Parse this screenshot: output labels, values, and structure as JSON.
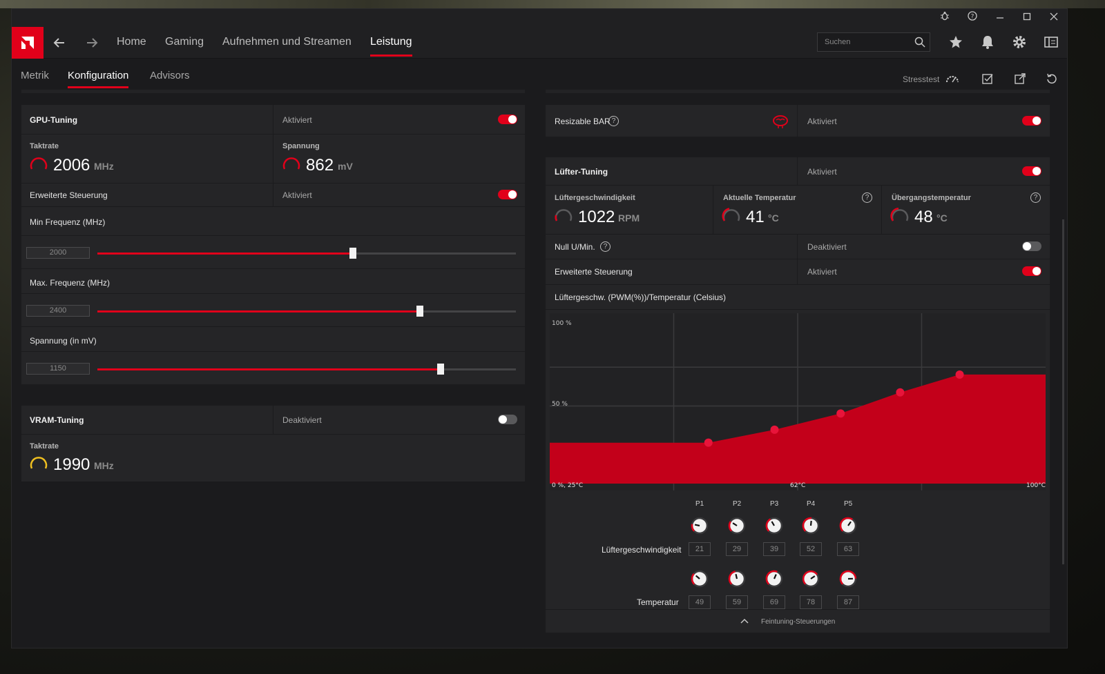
{
  "nav": {
    "home": "Home",
    "gaming": "Gaming",
    "record": "Aufnehmen und Streamen",
    "performance": "Leistung",
    "search_placeholder": "Suchen"
  },
  "subnav": {
    "metrics": "Metrik",
    "config": "Konfiguration",
    "advisors": "Advisors",
    "stresstest": "Stresstest"
  },
  "gpu": {
    "title": "GPU-Tuning",
    "status": "Aktiviert",
    "clock_label": "Taktrate",
    "clock_value": "2006",
    "clock_unit": "MHz",
    "voltage_label": "Spannung",
    "voltage_value": "862",
    "voltage_unit": "mV",
    "adv_label": "Erweiterte Steuerung",
    "adv_status": "Aktiviert",
    "min_freq_label": "Min Frequenz (MHz)",
    "min_freq_value": "2000",
    "min_freq_fraction": 0.61,
    "max_freq_label": "Max. Frequenz (MHz)",
    "max_freq_value": "2400",
    "max_freq_fraction": 0.77,
    "volt_label": "Spannung (in mV)",
    "volt_value": "1150",
    "volt_fraction": 0.82
  },
  "vram": {
    "title": "VRAM-Tuning",
    "status": "Deaktiviert",
    "clock_label": "Taktrate",
    "clock_value": "1990",
    "clock_unit": "MHz"
  },
  "rebar": {
    "label": "Resizable BAR",
    "status": "Aktiviert"
  },
  "fan": {
    "title": "Lüfter-Tuning",
    "status": "Aktiviert",
    "speed_label": "Lüftergeschwindigkeit",
    "speed_value": "1022",
    "speed_unit": "RPM",
    "temp_label": "Aktuelle Temperatur",
    "temp_value": "41",
    "temp_unit": "°C",
    "junction_label": "Übergangstemperatur",
    "junction_value": "48",
    "junction_unit": "°C",
    "zero_rpm_label": "Null U/Min.",
    "zero_rpm_status": "Deaktiviert",
    "adv_label": "Erweiterte Steuerung",
    "adv_status": "Aktiviert",
    "curve_label": "Lüftergeschw. (PWM(%))/Temperatur (Celsius)",
    "chart_top": "100 %",
    "chart_mid": "50 %",
    "chart_origin": "0 %, 25°C",
    "chart_midtemp": "62°C",
    "chart_maxtemp": "100°C",
    "points": [
      "P1",
      "P2",
      "P3",
      "P4",
      "P5"
    ],
    "row_speed_label": "Lüftergeschwindigkeit",
    "row_temp_label": "Temperatur",
    "speeds": [
      "21",
      "29",
      "39",
      "52",
      "63"
    ],
    "temps": [
      "49",
      "59",
      "69",
      "78",
      "87"
    ],
    "fine_tuning": "Feintuning-Steuerungen"
  },
  "chart_data": {
    "type": "area",
    "x": [
      25,
      49,
      59,
      69,
      78,
      87,
      100
    ],
    "y": [
      21,
      21,
      29,
      39,
      52,
      63,
      63
    ],
    "xlim": [
      25,
      100
    ],
    "ylim": [
      0,
      100
    ],
    "xlabel": "",
    "ylabel": ""
  },
  "colors": {
    "accent": "#e1001a",
    "clock_gauge_vram": "#f0c020"
  }
}
